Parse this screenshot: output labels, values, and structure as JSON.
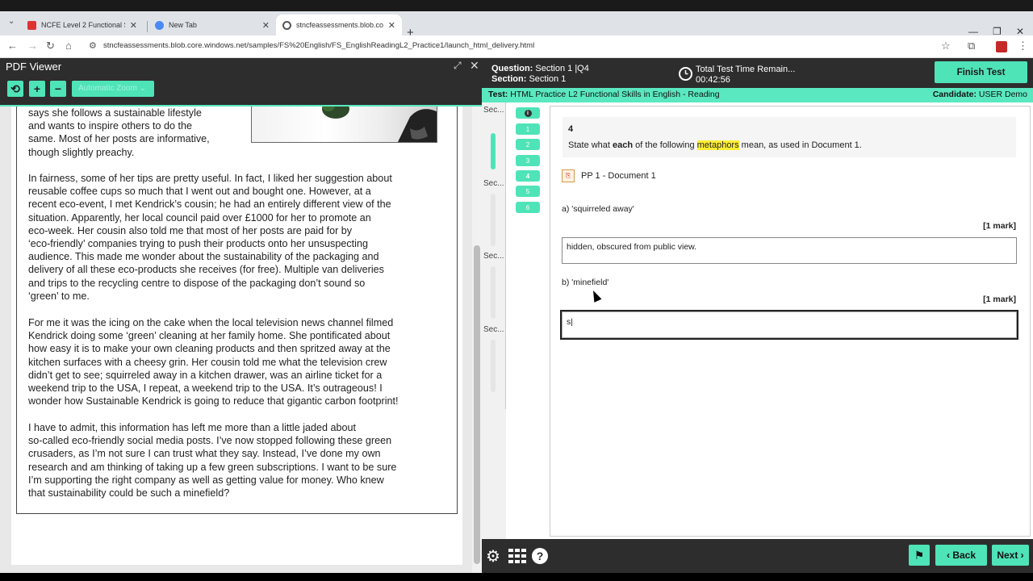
{
  "browser": {
    "tabs": [
      {
        "label": "NCFE Level 2 Functional Skills C",
        "close": "✕"
      },
      {
        "label": "New Tab",
        "close": "✕"
      },
      {
        "label": "stncfeassessments.blob.core.wi",
        "close": "✕"
      }
    ],
    "new_tab": "+",
    "url": "stncfeassessments.blob.core.windows.net/samples/FS%20English/FS_EnglishReadingL2_Practice1/launch_html_delivery.html"
  },
  "pdf_viewer": {
    "title": "PDF Viewer",
    "zoom": "Automatic Zoom",
    "paragraphs": [
      [
        "says she follows a sustainable lifestyle",
        "and wants to inspire others to do the",
        "same. Most of her posts are informative,",
        "though slightly preachy."
      ],
      [
        "In fairness, some of her tips are pretty useful. In fact, I liked her suggestion about",
        "reusable coffee cups so much that I went out and bought one. However, at a",
        "recent eco-event, I met Kendrick’s cousin; he had an entirely different view of the",
        "situation. Apparently, her local council paid over £1000 for her to promote an",
        "eco-week. Her cousin also told me that most of her posts are paid for by",
        "‘eco-friendly’ companies trying to push their products onto her unsuspecting",
        "audience. This made me wonder about the sustainability of the packaging and",
        "delivery of all these eco-products she receives (for free). Multiple van deliveries",
        "and trips to the recycling centre to dispose of the packaging don’t sound so",
        "‘green’ to me."
      ],
      [
        "For me it was the icing on the cake when the local television news channel filmed",
        "Kendrick doing some ‘green’ cleaning at her family home. She pontificated about",
        "how easy it is to make your own cleaning products and then spritzed away at the",
        "kitchen surfaces with a cheesy grin. Her cousin told me what the television crew",
        "didn’t get to see; squirreled away in a kitchen drawer, was an airline ticket for a",
        "weekend trip to the USA, I repeat, a weekend trip to the USA. It’s outrageous! I",
        "wonder how Sustainable Kendrick is going to reduce that gigantic carbon footprint!"
      ],
      [
        "I have to admit, this information has left me more than a little jaded about",
        "so-called eco-friendly social media posts. I’ve now stopped following these green",
        "crusaders, as I’m not sure I can trust what they say. Instead, I’ve done my own",
        "research and am thinking of taking up a few green subscriptions. I want to be sure",
        "I’m supporting the right company as well as getting value for money. Who knew",
        "that sustainability could be such a minefield?"
      ]
    ]
  },
  "test": {
    "question_label": "Question:",
    "question_value": "Section 1 |Q4",
    "section_label": "Section:",
    "section_value": "Section 1",
    "time_label": "Total Test Time Remain...",
    "time_value": "00:42:56",
    "finish_button": "Finish Test",
    "test_label": "Test:",
    "test_name": "HTML Practice L2 Functional Skills in English - Reading",
    "candidate_label": "Candidate:",
    "candidate_name": "USER Demo",
    "sections": [
      "Sec...",
      "Sec...",
      "Sec...",
      "Sec..."
    ],
    "question_numbers": [
      "1",
      "2",
      "3",
      "4",
      "5",
      "6"
    ],
    "question": {
      "number": "4",
      "text_before": "State what ",
      "text_bold": "each",
      "text_mid": " of the following ",
      "text_highlight": "metaphors",
      "text_after": " mean, as used in Document 1.",
      "document_link": "PP 1 - Document 1",
      "parts": [
        {
          "label": "a) 'squirreled away'",
          "mark": "[1 mark]",
          "answer": "hidden, obscured from public view."
        },
        {
          "label": "b) 'minefield'",
          "mark": "[1 mark]",
          "answer": "s|"
        }
      ]
    },
    "nav": {
      "back": "Back",
      "next": "Next"
    }
  }
}
